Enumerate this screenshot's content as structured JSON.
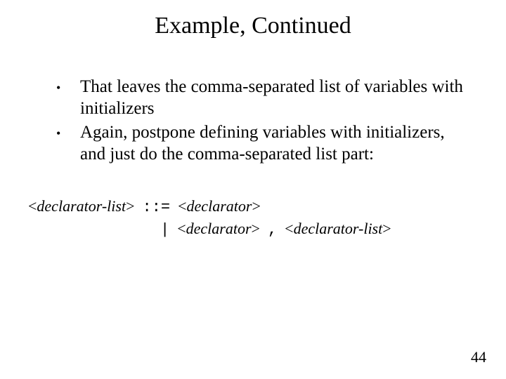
{
  "title": "Example, Continued",
  "bullets": [
    {
      "text": "That leaves the comma-separated list of variables with initializers"
    },
    {
      "text": "Again, postpone defining variables with initializers, and just do the comma-separated list part:"
    }
  ],
  "grammar": {
    "lhs": "declarator-list",
    "op": "::=",
    "rhs1": "declarator",
    "alt": "|",
    "rhs2_a": "declarator",
    "rhs2_sep": ",",
    "rhs2_b": "declarator-list"
  },
  "page_number": "44"
}
